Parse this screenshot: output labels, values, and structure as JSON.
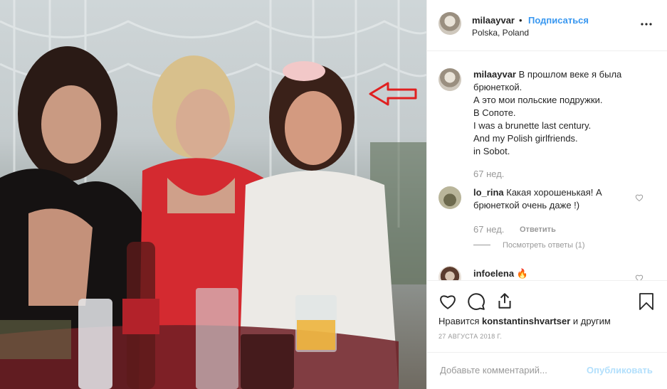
{
  "photo": {
    "alt_icon": "photo-with-red-arrow"
  },
  "post": {
    "username": "milaayvar",
    "separator": "•",
    "follow_label": "Подписаться",
    "location": "Polska, Poland",
    "more_icon": "more-dots-icon"
  },
  "caption": {
    "username": "milaayvar",
    "text": "В прошлом веке я была брюнеткой.\nА это мои польские подружки.\nВ Сопоте.\nI was a brunette last century.\nAnd my Polish girlfriends.\nin Sobot.",
    "age": "67 нед."
  },
  "comments": [
    {
      "username": "lo_rina",
      "text": "Какая хорошенькая! А брюнеткой очень даже !)",
      "age": "67 нед.",
      "reply_label": "Ответить",
      "view_replies": "Посмотреть ответы (1)"
    },
    {
      "username": "infoelena",
      "emoji": "🔥"
    }
  ],
  "likes": {
    "prefix": "Нравится",
    "user": "konstantinshvartser",
    "suffix": "и другим"
  },
  "date": "27 АВГУСТА 2018 Г.",
  "add_comment": {
    "placeholder": "Добавьте комментарий...",
    "publish_label": "Опубликовать"
  },
  "colors": {
    "link": "#3897f0",
    "muted": "#999999",
    "arrow": "#e02020"
  }
}
